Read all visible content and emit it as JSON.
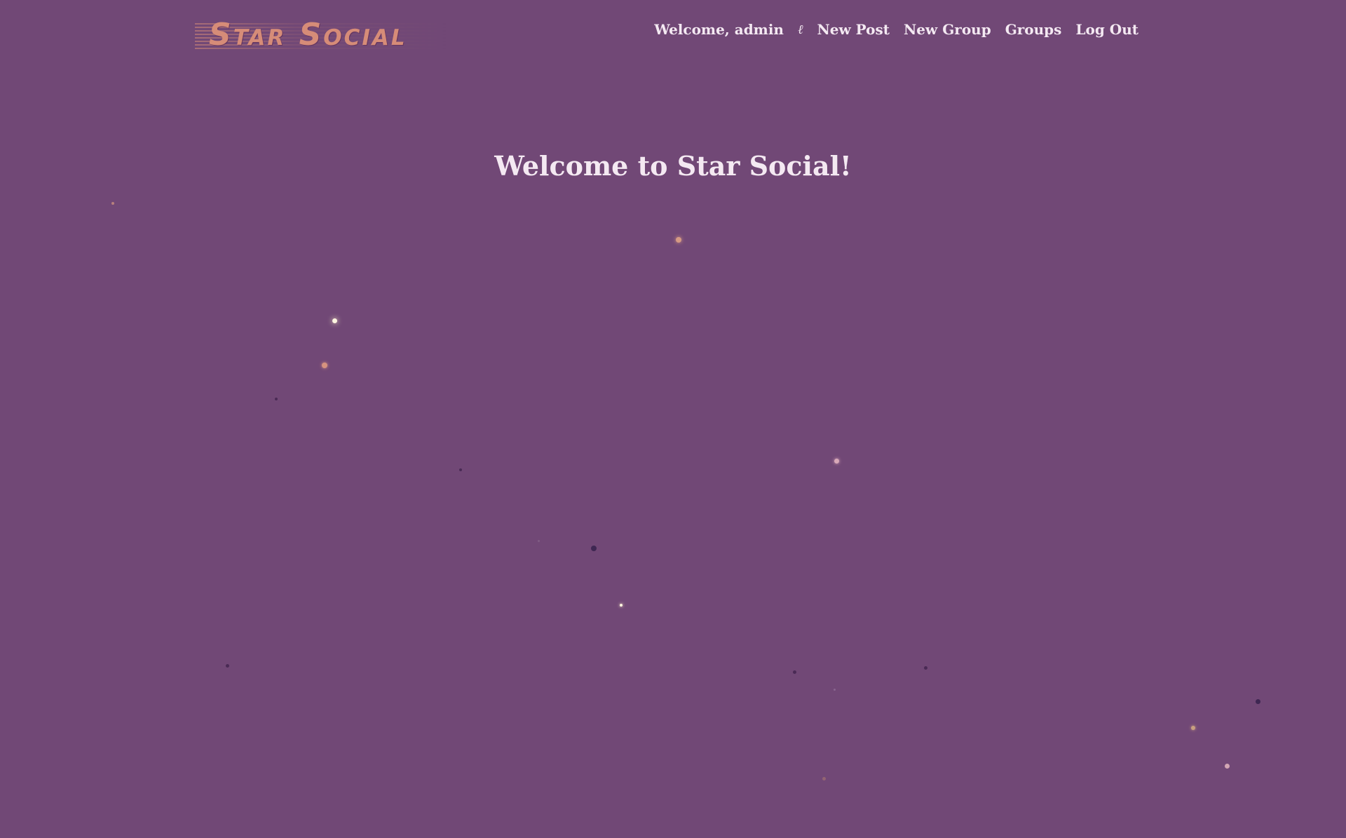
{
  "navbar": {
    "brand": "Star Social",
    "welcome": "Welcome, admin",
    "user_icon": "ℓ",
    "links": [
      {
        "label": "New Post"
      },
      {
        "label": "New Group"
      },
      {
        "label": "Groups"
      },
      {
        "label": "Log Out"
      }
    ]
  },
  "main": {
    "title": "Welcome to Star Social!"
  },
  "colors": {
    "background": "#714876",
    "brand": "#d68c78",
    "text": "#f4e9f2"
  }
}
